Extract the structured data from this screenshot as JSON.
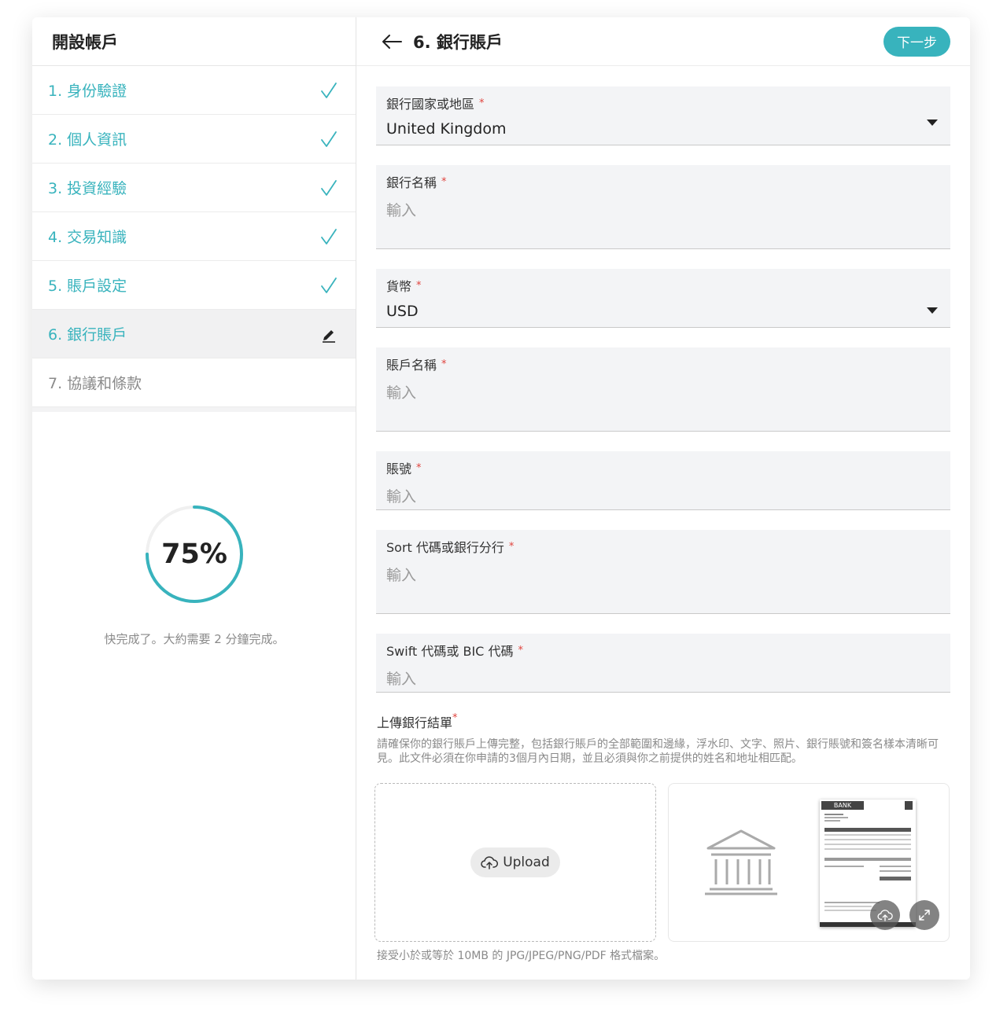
{
  "sidebar": {
    "title": "開設帳戶",
    "steps": [
      {
        "label": "1. 身份驗證",
        "state": "done",
        "icon": "check-icon"
      },
      {
        "label": "2. 個人資訊",
        "state": "done",
        "icon": "check-icon"
      },
      {
        "label": "3. 投資經驗",
        "state": "done",
        "icon": "check-icon"
      },
      {
        "label": "4. 交易知識",
        "state": "done",
        "icon": "check-icon"
      },
      {
        "label": "5. 賬戶設定",
        "state": "done",
        "icon": "check-icon"
      },
      {
        "label": "6. 銀行賬戶",
        "state": "active",
        "icon": "pencil-icon"
      },
      {
        "label": "7. 協議和條款",
        "state": "pending",
        "icon": ""
      }
    ],
    "progress": {
      "value": 0.75,
      "text": "75%",
      "note": "快完成了。大約需要 2 分鐘完成。"
    }
  },
  "header": {
    "title": "6. 銀行賬戶",
    "next_label": "下一步",
    "back_icon": "arrow-left-icon"
  },
  "fields": {
    "country": {
      "label": "銀行國家或地區",
      "value": "United Kingdom"
    },
    "bank_name": {
      "label": "銀行名稱",
      "placeholder": "輸入"
    },
    "currency": {
      "label": "貨幣",
      "value": "USD"
    },
    "account_name": {
      "label": "賬戶名稱",
      "placeholder": "輸入"
    },
    "account_number": {
      "label": "賬號",
      "placeholder": "輸入"
    },
    "sort_code": {
      "label": "Sort 代碼或銀行分行",
      "placeholder": "輸入"
    },
    "swift": {
      "label": "Swift 代碼或 BIC 代碼",
      "placeholder": "輸入"
    }
  },
  "required_mark": "*",
  "upload": {
    "title": "上傳銀行結單",
    "description": "請確保你的銀行賬戶上傳完整，包括銀行賬戶的全部範圍和邊緣，浮水印、文字、照片、銀行賬號和簽名樣本清晰可見。此文件必須在你申請的3個月內日期，並且必須與你之前提供的姓名和地址相匹配。",
    "button_label": "Upload",
    "note": "接受小於或等於 10MB 的 JPG/JPEG/PNG/PDF 格式檔案。",
    "sample_doc_header": "BANK"
  },
  "colors": {
    "accent": "#38b3bd",
    "required": "#e0443e"
  }
}
